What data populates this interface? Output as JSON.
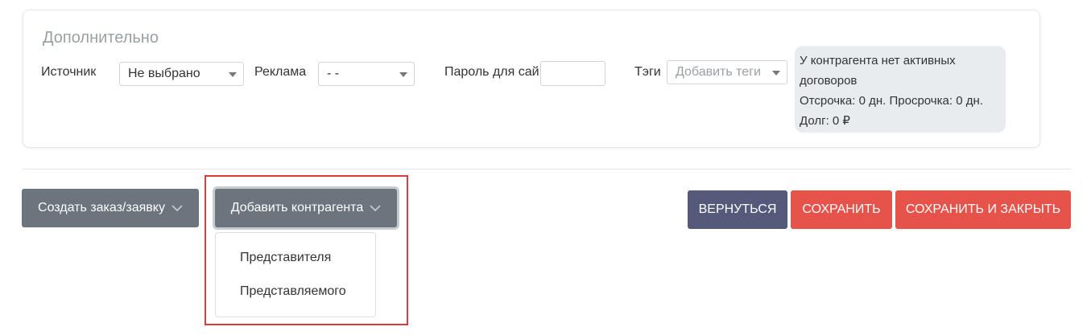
{
  "section": {
    "title": "Дополнительно"
  },
  "fields": {
    "source": {
      "label": "Источник",
      "value": "Не выбрано"
    },
    "ad": {
      "label": "Реклама",
      "value": "- -"
    },
    "site_password": {
      "label": "Пароль для сай",
      "value": ""
    },
    "tags": {
      "label": "Тэги",
      "placeholder": "Добавить теги"
    }
  },
  "contract_info": {
    "line1": "У контрагента нет активных",
    "line2": "договоров",
    "line3": "Отсрочка: 0 дн. Просрочка: 0 дн.",
    "line4": "Долг: 0 ₽"
  },
  "actions": {
    "create_order": "Создать заказ/заявку",
    "add_counterparty": "Добавить контрагента",
    "back": "ВЕРНУТЬСЯ",
    "save": "СОХРАНИТЬ",
    "save_close": "СОХРАНИТЬ И ЗАКРЫТЬ"
  },
  "add_counterparty_menu": [
    {
      "label": "Представителя"
    },
    {
      "label": "Представляемого"
    }
  ],
  "colors": {
    "gray_button": "#6c757d",
    "navy_button": "#555a7a",
    "red_button": "#e5534b",
    "highlight": "#e03a3a"
  }
}
